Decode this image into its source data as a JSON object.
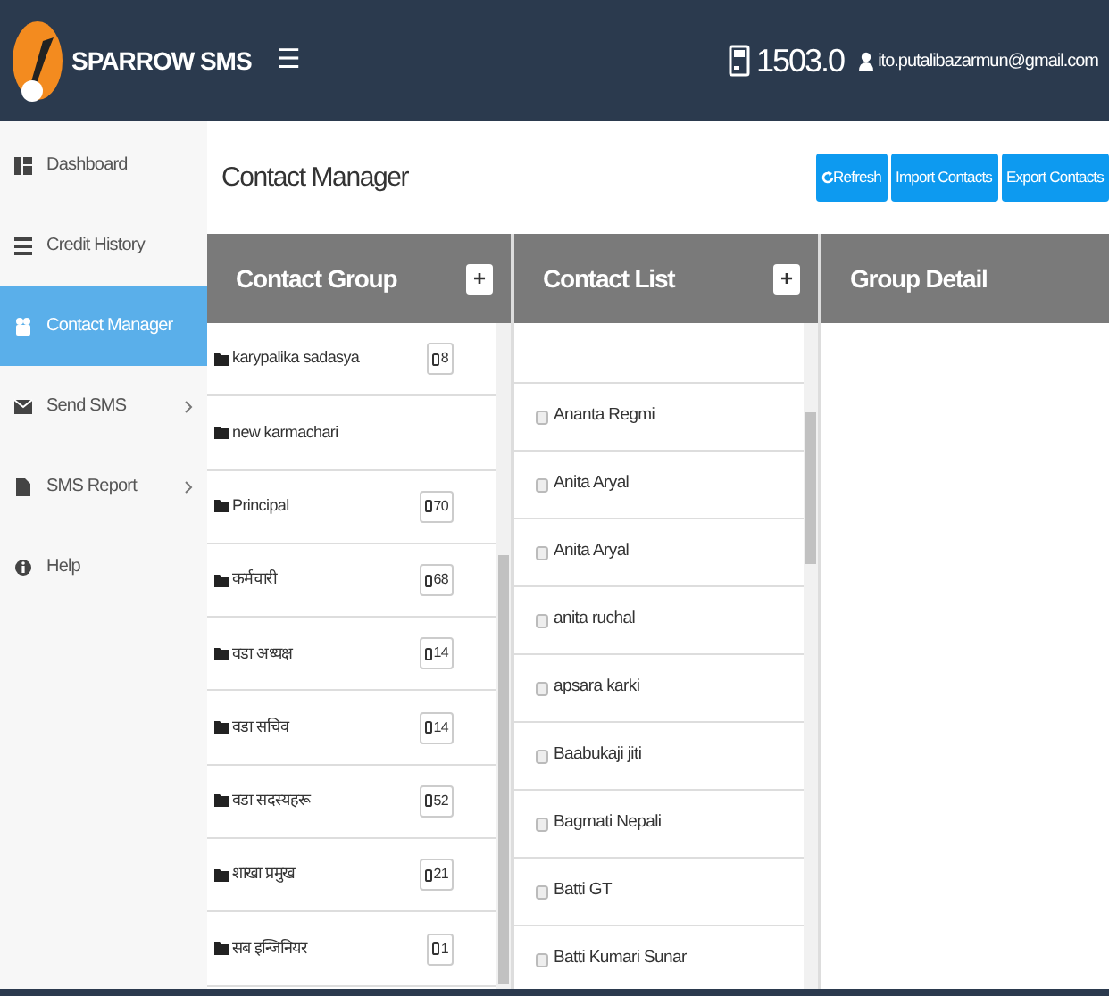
{
  "header": {
    "brand": "SPARROW SMS",
    "menu_glyph": "☰",
    "credit": "1503.0",
    "user": "ito.putalibazarmun@gmail.com"
  },
  "sidebar": {
    "items": [
      {
        "label": "Dashboard",
        "selected": false
      },
      {
        "label": "Credit History",
        "selected": false
      },
      {
        "label": "Contact Manager",
        "selected": true
      },
      {
        "label": "Send SMS",
        "selected": false
      },
      {
        "label": "SMS Report",
        "selected": false
      },
      {
        "label": "Help",
        "selected": false
      }
    ]
  },
  "page_title": "Contact Manager",
  "buttons": [
    {
      "label": "Refresh"
    },
    {
      "label": "Import Contacts"
    },
    {
      "label": "Export Contacts"
    }
  ],
  "contact_group": {
    "title": "Contact Group",
    "add_glyph": "+",
    "groups": [
      {
        "name": "karypalika sadasya",
        "count": "8"
      },
      {
        "name": "new karmachari"
      },
      {
        "name": "Principal",
        "count": "70"
      },
      {
        "name": "कर्मचारी",
        "count": "68"
      },
      {
        "name": "वडा अध्यक्ष",
        "count": "14"
      },
      {
        "name": "वडा सचिव",
        "count": "14"
      },
      {
        "name": "वडा सदस्यहरू",
        "count": "52"
      },
      {
        "name": "शाखा प्रमुख",
        "count": "21"
      },
      {
        "name": "सब इन्जिनियर",
        "count": "1"
      }
    ]
  },
  "contact_list": {
    "title": "Contact List",
    "add_glyph": "+",
    "contacts": [
      {
        "name": "Ananta Regmi",
        "checked": false
      },
      {
        "name": "Anita Aryal",
        "checked": false
      },
      {
        "name": "Anita Aryal",
        "checked": false
      },
      {
        "name": "anita ruchal",
        "checked": false
      },
      {
        "name": "apsara karki",
        "checked": false
      },
      {
        "name": "Baabukaji jiti",
        "checked": false
      },
      {
        "name": "Bagmati Nepali",
        "checked": false
      },
      {
        "name": "Batti GT",
        "checked": false
      },
      {
        "name": "Batti Kumari Sunar",
        "checked": false
      }
    ]
  },
  "group_detail": {
    "title": "Group Detail"
  }
}
